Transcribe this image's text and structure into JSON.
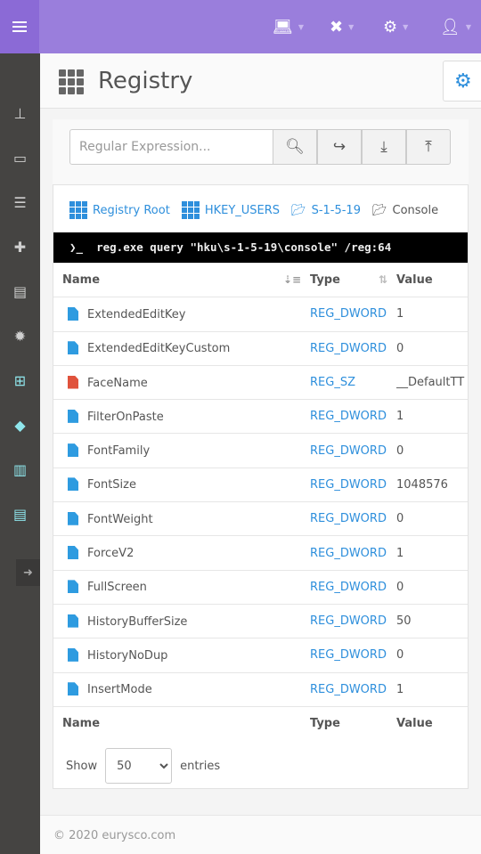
{
  "topbar": {
    "icons": [
      "menu-icon",
      "laptop-icon",
      "tools-icon",
      "cogs-icon",
      "user-icon"
    ],
    "brand_color": "#9a7edc"
  },
  "sidebar": {
    "items": [
      "sitemap-icon",
      "monitor-chart-icon",
      "list-icon",
      "clipboard-plus-icon",
      "file-chart-icon",
      "certificate-icon",
      "windows-icon",
      "tag-icon",
      "barcode-icon",
      "server-clock-icon"
    ],
    "collapse": "sign-in-icon"
  },
  "header": {
    "title": "Registry",
    "settings": "gear-icon"
  },
  "search": {
    "placeholder": "Regular Expression...",
    "value": ""
  },
  "breadcrumb": [
    {
      "label": "Registry Root"
    },
    {
      "label": "HKEY_USERS"
    },
    {
      "label": "S-1-5-19"
    },
    {
      "label": "Console"
    }
  ],
  "command": "❯_  reg.exe query \"hku\\s-1-5-19\\console\" /reg:64",
  "table": {
    "headers": {
      "name": "Name",
      "type": "Type",
      "value": "Value"
    },
    "rows": [
      {
        "name": "ExtendedEditKey",
        "type": "REG_DWORD",
        "value": "1",
        "color": "#2e9be0"
      },
      {
        "name": "ExtendedEditKeyCustom",
        "type": "REG_DWORD",
        "value": "0",
        "color": "#2e9be0"
      },
      {
        "name": "FaceName",
        "type": "REG_SZ",
        "value": "__DefaultTT",
        "color": "#e0523c"
      },
      {
        "name": "FilterOnPaste",
        "type": "REG_DWORD",
        "value": "1",
        "color": "#2e9be0"
      },
      {
        "name": "FontFamily",
        "type": "REG_DWORD",
        "value": "0",
        "color": "#2e9be0"
      },
      {
        "name": "FontSize",
        "type": "REG_DWORD",
        "value": "1048576",
        "color": "#2e9be0"
      },
      {
        "name": "FontWeight",
        "type": "REG_DWORD",
        "value": "0",
        "color": "#2e9be0"
      },
      {
        "name": "ForceV2",
        "type": "REG_DWORD",
        "value": "1",
        "color": "#2e9be0"
      },
      {
        "name": "FullScreen",
        "type": "REG_DWORD",
        "value": "0",
        "color": "#2e9be0"
      },
      {
        "name": "HistoryBufferSize",
        "type": "REG_DWORD",
        "value": "50",
        "color": "#2e9be0"
      },
      {
        "name": "HistoryNoDup",
        "type": "REG_DWORD",
        "value": "0",
        "color": "#2e9be0"
      },
      {
        "name": "InsertMode",
        "type": "REG_DWORD",
        "value": "1",
        "color": "#2e9be0"
      }
    ]
  },
  "length": {
    "show": "Show",
    "selected": "50",
    "entries": "entries"
  },
  "footer": "© 2020 eurysco.com"
}
